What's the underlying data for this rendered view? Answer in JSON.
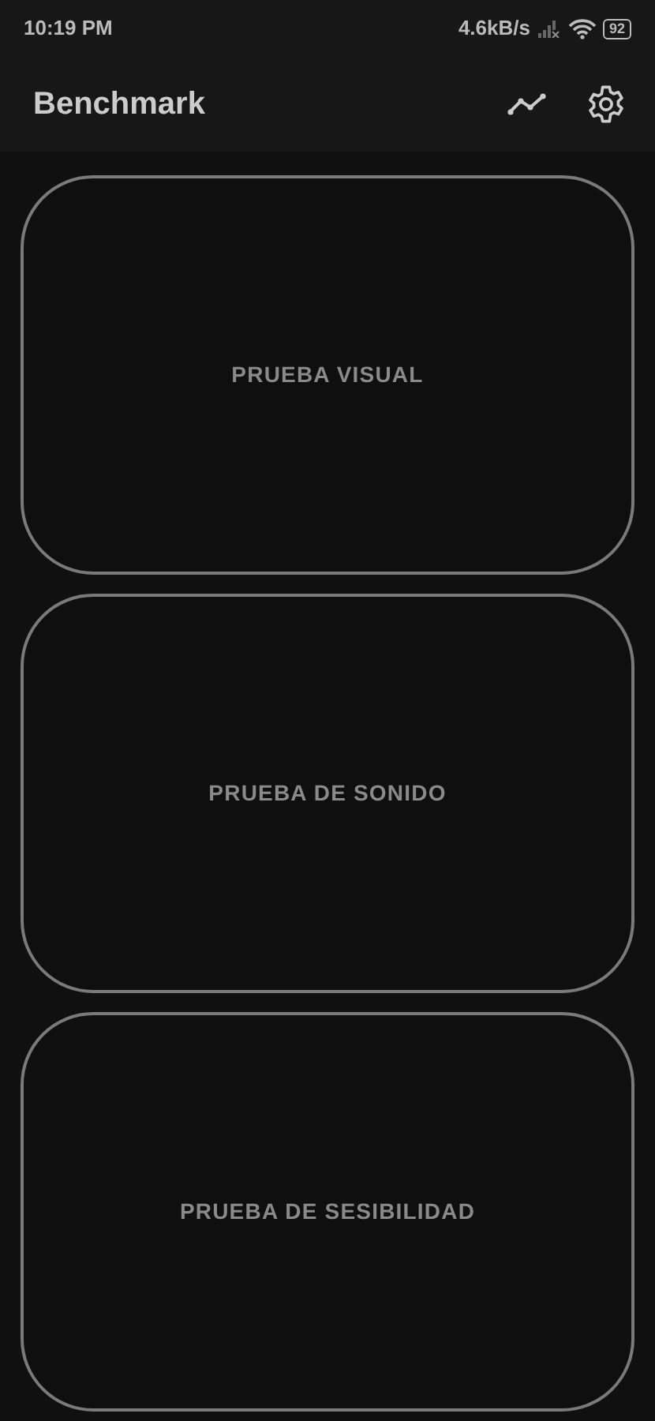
{
  "status_bar": {
    "time": "10:19 PM",
    "speed": "4.6kB/s",
    "battery": "92"
  },
  "app_bar": {
    "title": "Benchmark"
  },
  "tests": [
    {
      "label": "PRUEBA VISUAL"
    },
    {
      "label": "PRUEBA DE SONIDO"
    },
    {
      "label": "PRUEBA DE SESIBILIDAD"
    }
  ]
}
